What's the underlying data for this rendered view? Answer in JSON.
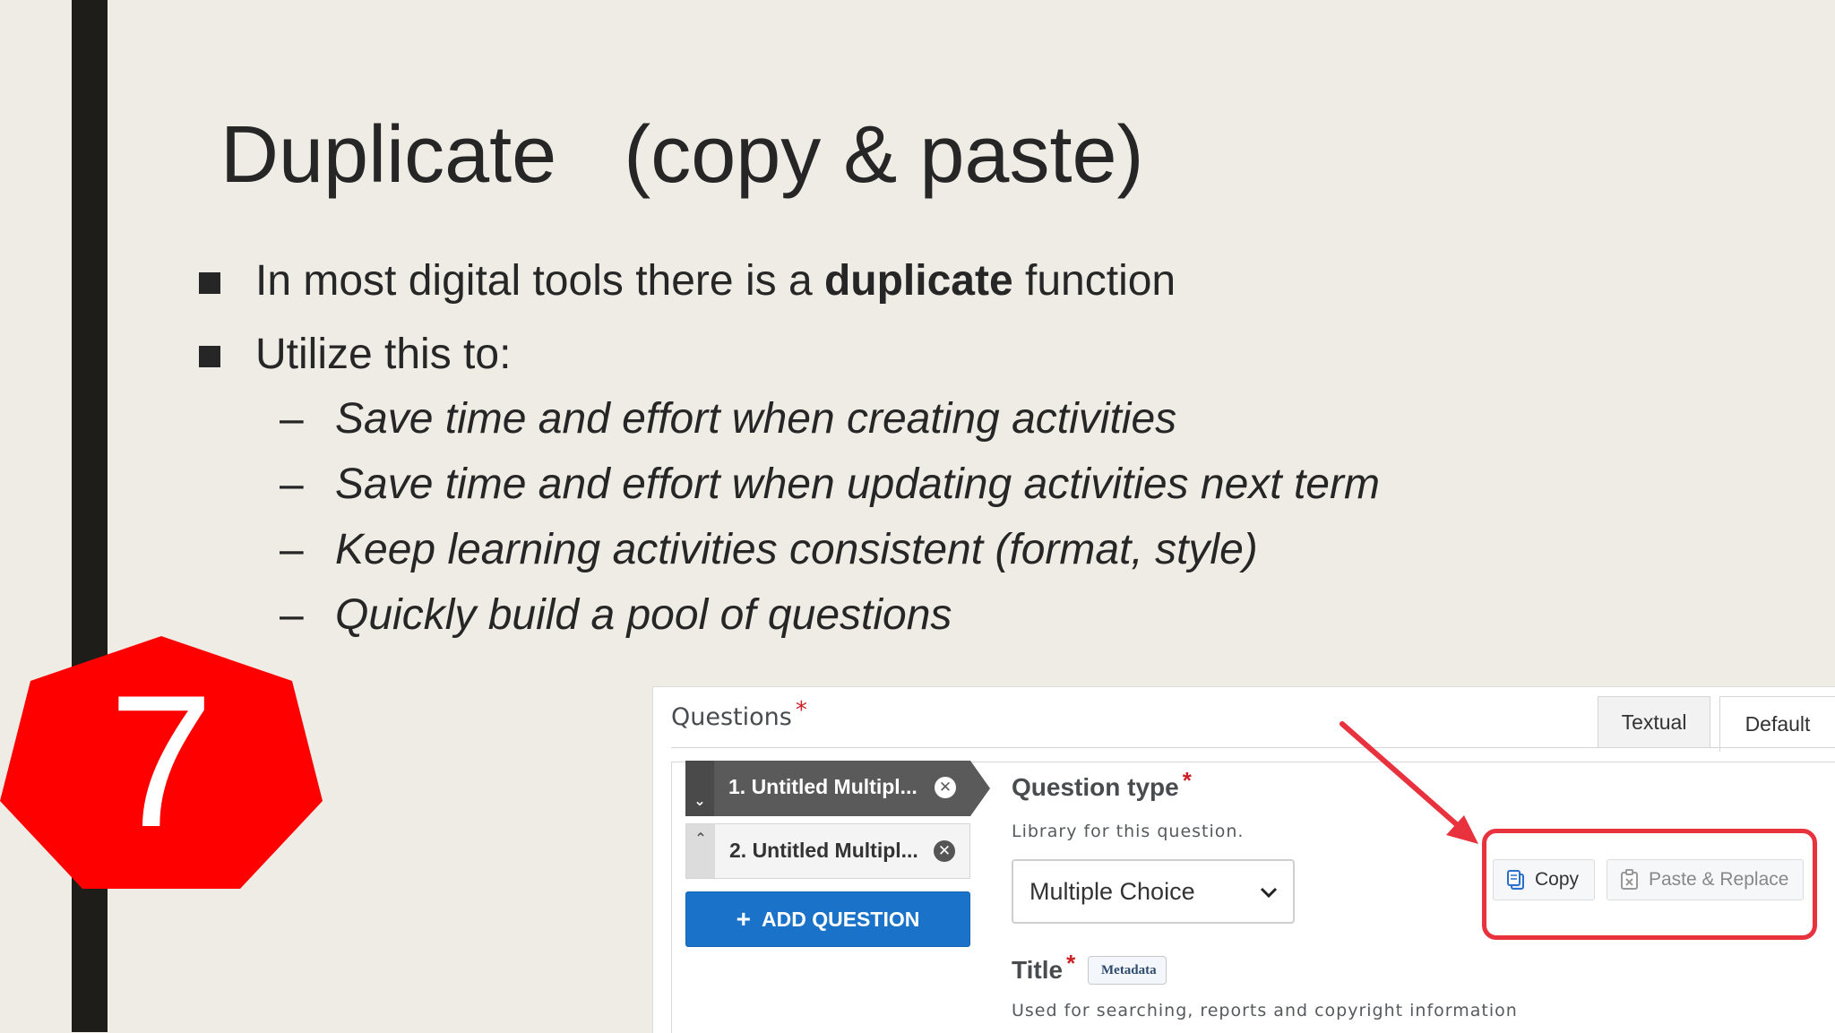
{
  "slide": {
    "title": "Duplicate   (copy & paste)",
    "bullets": [
      {
        "pre": "In most digital tools there is a ",
        "bold": "duplicate",
        "post": " function"
      },
      {
        "pre": "Utilize this to:",
        "bold": "",
        "post": ""
      }
    ],
    "sub_bullets": [
      "Save time and effort when creating activities",
      "Save time and effort when updating activities next term",
      "Keep learning activities consistent (format, style)",
      "Quickly build a pool of questions"
    ],
    "dash": "–",
    "badge_number": "7",
    "badge_color": "#ff0000"
  },
  "ui": {
    "questions_label": "Questions",
    "required_mark": "*",
    "tabs": [
      "Textual",
      "Default"
    ],
    "question_items": [
      {
        "label": "1. Untitled Multipl...",
        "state": "selected",
        "handle_icon": "chevron-down-icon"
      },
      {
        "label": "2. Untitled Multipl...",
        "state": "normal",
        "handle_icon": "chevron-up-icon"
      }
    ],
    "add_question_label": "ADD QUESTION",
    "question_type": {
      "label": "Question type",
      "help": "Library for this question.",
      "selected": "Multiple Choice"
    },
    "title_field": {
      "label": "Title",
      "badge": "Metadata",
      "help": "Used for searching, reports and copyright information"
    },
    "copy_label": "Copy",
    "paste_label": "Paste & Replace",
    "accent_color": "#1a73c9",
    "highlight_color": "#e8323d"
  }
}
